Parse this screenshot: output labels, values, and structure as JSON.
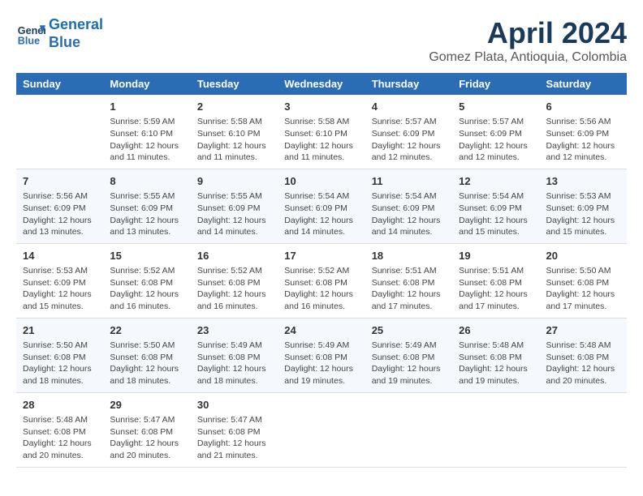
{
  "header": {
    "logo_line1": "General",
    "logo_line2": "Blue",
    "title": "April 2024",
    "subtitle": "Gomez Plata, Antioquia, Colombia"
  },
  "weekdays": [
    "Sunday",
    "Monday",
    "Tuesday",
    "Wednesday",
    "Thursday",
    "Friday",
    "Saturday"
  ],
  "weeks": [
    [
      {
        "day": "",
        "info": ""
      },
      {
        "day": "1",
        "info": "Sunrise: 5:59 AM\nSunset: 6:10 PM\nDaylight: 12 hours\nand 11 minutes."
      },
      {
        "day": "2",
        "info": "Sunrise: 5:58 AM\nSunset: 6:10 PM\nDaylight: 12 hours\nand 11 minutes."
      },
      {
        "day": "3",
        "info": "Sunrise: 5:58 AM\nSunset: 6:10 PM\nDaylight: 12 hours\nand 11 minutes."
      },
      {
        "day": "4",
        "info": "Sunrise: 5:57 AM\nSunset: 6:09 PM\nDaylight: 12 hours\nand 12 minutes."
      },
      {
        "day": "5",
        "info": "Sunrise: 5:57 AM\nSunset: 6:09 PM\nDaylight: 12 hours\nand 12 minutes."
      },
      {
        "day": "6",
        "info": "Sunrise: 5:56 AM\nSunset: 6:09 PM\nDaylight: 12 hours\nand 12 minutes."
      }
    ],
    [
      {
        "day": "7",
        "info": "Sunrise: 5:56 AM\nSunset: 6:09 PM\nDaylight: 12 hours\nand 13 minutes."
      },
      {
        "day": "8",
        "info": "Sunrise: 5:55 AM\nSunset: 6:09 PM\nDaylight: 12 hours\nand 13 minutes."
      },
      {
        "day": "9",
        "info": "Sunrise: 5:55 AM\nSunset: 6:09 PM\nDaylight: 12 hours\nand 14 minutes."
      },
      {
        "day": "10",
        "info": "Sunrise: 5:54 AM\nSunset: 6:09 PM\nDaylight: 12 hours\nand 14 minutes."
      },
      {
        "day": "11",
        "info": "Sunrise: 5:54 AM\nSunset: 6:09 PM\nDaylight: 12 hours\nand 14 minutes."
      },
      {
        "day": "12",
        "info": "Sunrise: 5:54 AM\nSunset: 6:09 PM\nDaylight: 12 hours\nand 15 minutes."
      },
      {
        "day": "13",
        "info": "Sunrise: 5:53 AM\nSunset: 6:09 PM\nDaylight: 12 hours\nand 15 minutes."
      }
    ],
    [
      {
        "day": "14",
        "info": "Sunrise: 5:53 AM\nSunset: 6:09 PM\nDaylight: 12 hours\nand 15 minutes."
      },
      {
        "day": "15",
        "info": "Sunrise: 5:52 AM\nSunset: 6:08 PM\nDaylight: 12 hours\nand 16 minutes."
      },
      {
        "day": "16",
        "info": "Sunrise: 5:52 AM\nSunset: 6:08 PM\nDaylight: 12 hours\nand 16 minutes."
      },
      {
        "day": "17",
        "info": "Sunrise: 5:52 AM\nSunset: 6:08 PM\nDaylight: 12 hours\nand 16 minutes."
      },
      {
        "day": "18",
        "info": "Sunrise: 5:51 AM\nSunset: 6:08 PM\nDaylight: 12 hours\nand 17 minutes."
      },
      {
        "day": "19",
        "info": "Sunrise: 5:51 AM\nSunset: 6:08 PM\nDaylight: 12 hours\nand 17 minutes."
      },
      {
        "day": "20",
        "info": "Sunrise: 5:50 AM\nSunset: 6:08 PM\nDaylight: 12 hours\nand 17 minutes."
      }
    ],
    [
      {
        "day": "21",
        "info": "Sunrise: 5:50 AM\nSunset: 6:08 PM\nDaylight: 12 hours\nand 18 minutes."
      },
      {
        "day": "22",
        "info": "Sunrise: 5:50 AM\nSunset: 6:08 PM\nDaylight: 12 hours\nand 18 minutes."
      },
      {
        "day": "23",
        "info": "Sunrise: 5:49 AM\nSunset: 6:08 PM\nDaylight: 12 hours\nand 18 minutes."
      },
      {
        "day": "24",
        "info": "Sunrise: 5:49 AM\nSunset: 6:08 PM\nDaylight: 12 hours\nand 19 minutes."
      },
      {
        "day": "25",
        "info": "Sunrise: 5:49 AM\nSunset: 6:08 PM\nDaylight: 12 hours\nand 19 minutes."
      },
      {
        "day": "26",
        "info": "Sunrise: 5:48 AM\nSunset: 6:08 PM\nDaylight: 12 hours\nand 19 minutes."
      },
      {
        "day": "27",
        "info": "Sunrise: 5:48 AM\nSunset: 6:08 PM\nDaylight: 12 hours\nand 20 minutes."
      }
    ],
    [
      {
        "day": "28",
        "info": "Sunrise: 5:48 AM\nSunset: 6:08 PM\nDaylight: 12 hours\nand 20 minutes."
      },
      {
        "day": "29",
        "info": "Sunrise: 5:47 AM\nSunset: 6:08 PM\nDaylight: 12 hours\nand 20 minutes."
      },
      {
        "day": "30",
        "info": "Sunrise: 5:47 AM\nSunset: 6:08 PM\nDaylight: 12 hours\nand 21 minutes."
      },
      {
        "day": "",
        "info": ""
      },
      {
        "day": "",
        "info": ""
      },
      {
        "day": "",
        "info": ""
      },
      {
        "day": "",
        "info": ""
      }
    ]
  ]
}
